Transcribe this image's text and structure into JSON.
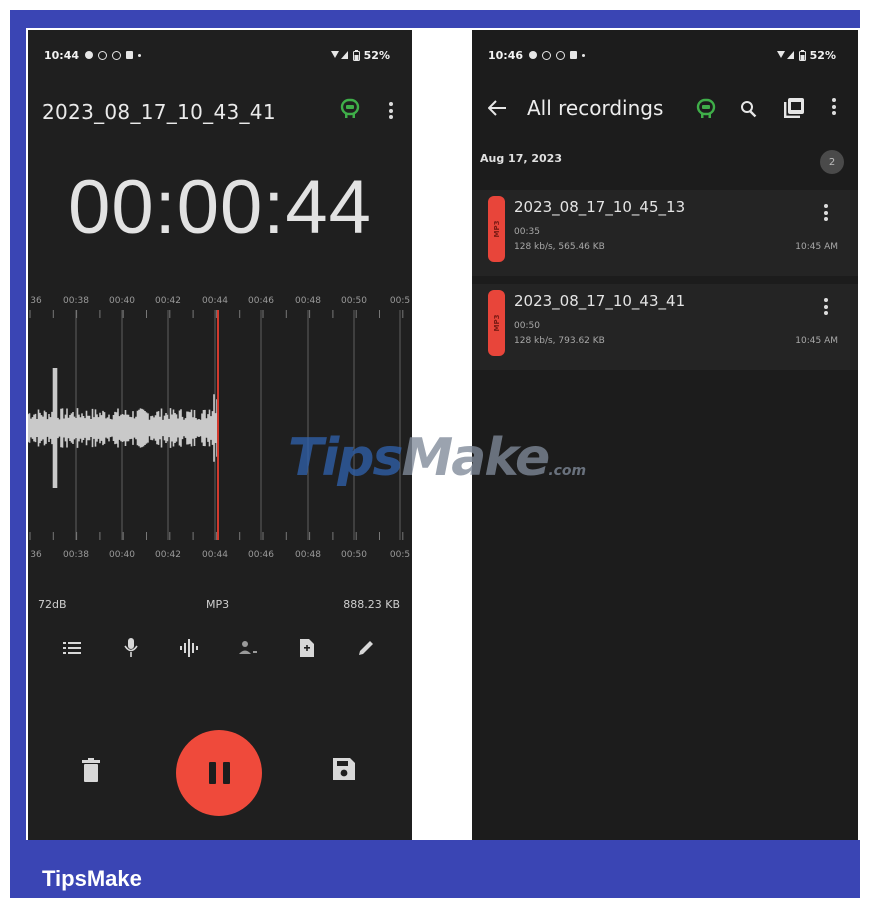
{
  "left_phone": {
    "status": {
      "time": "10:44",
      "battery": "52%"
    },
    "recording_title": "2023_08_17_10_43_41",
    "timer": "00:00:44",
    "timeline_top_labels": [
      "36",
      "00:38",
      "00:40",
      "00:42",
      "00:44",
      "00:46",
      "00:48",
      "00:50",
      "00:5"
    ],
    "timeline_bottom_labels": [
      "36",
      "00:38",
      "00:40",
      "00:42",
      "00:44",
      "00:46",
      "00:48",
      "00:50",
      "00:5"
    ],
    "level": "72dB",
    "format": "MP3",
    "size": "888.23 KB",
    "toolbar_icons": [
      "list-icon",
      "mic-icon",
      "waveform-icon",
      "person-icon",
      "document-icon",
      "pencil-icon"
    ],
    "actions": {
      "delete": "trash-icon",
      "pause": "pause-icon",
      "save": "save-icon"
    },
    "accent_color": "#ef4a3b",
    "bot_icon_color": "#3fae49"
  },
  "right_phone": {
    "status": {
      "time": "10:46",
      "battery": "52%"
    },
    "header_title": "All recordings",
    "date_group": "Aug 17, 2023",
    "count": "2",
    "recordings": [
      {
        "name": "2023_08_17_10_45_13",
        "duration": "00:35",
        "info": "128 kb/s, 565.46 KB",
        "time": "10:45 AM",
        "format": "MP3"
      },
      {
        "name": "2023_08_17_10_43_41",
        "duration": "00:50",
        "info": "128 kb/s, 793.62 KB",
        "time": "10:45 AM",
        "format": "MP3"
      }
    ]
  },
  "watermark": {
    "part1": "Tips",
    "part2": "Make",
    "part3": ".com"
  },
  "footer_brand": "TipsMake",
  "frame_color": "#3a45b4"
}
